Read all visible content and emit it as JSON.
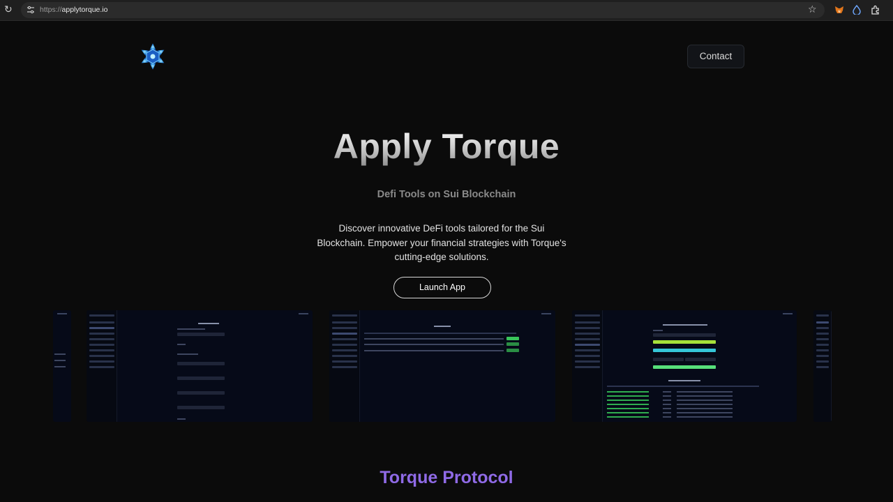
{
  "browser": {
    "url_scheme": "https://",
    "url_host": "applytorque.io",
    "icons": [
      "reload-icon",
      "tune-icon",
      "star-icon",
      "metamask-icon",
      "drop-icon",
      "extensions-icon"
    ]
  },
  "header": {
    "contact_label": "Contact"
  },
  "hero": {
    "title": "Apply Torque",
    "subtitle": "Defi Tools on Sui Blockchain",
    "description": "Discover innovative DeFi tools tailored for the Sui Blockchain. Empower your financial strategies with Torque's cutting-edge solutions.",
    "cta_label": "Launch App"
  },
  "showcase": {
    "titles": [
      "CREATE VESTING",
      "My Vestings",
      "Send Coins to Multiple Recipients",
      "RECENT TRANSACTIONS"
    ]
  },
  "section": {
    "title": "Torque Protocol"
  },
  "colors": {
    "accent_purple": "#8f6ae6",
    "background": "#0b0b0b"
  }
}
